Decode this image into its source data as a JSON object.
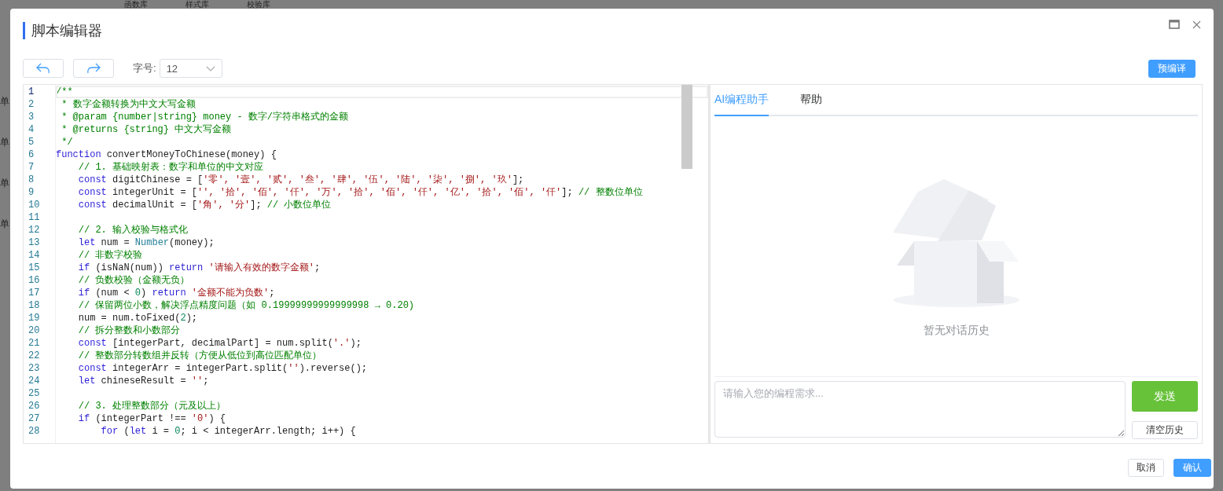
{
  "background": {
    "tabs": [
      "函数库",
      "样式库",
      "校验库"
    ],
    "row_labels": [
      "单",
      "单",
      "单",
      "单"
    ]
  },
  "dialog": {
    "title": "脚本编辑器"
  },
  "toolbar": {
    "font_size_label": "字号:",
    "font_size": "12",
    "precompile_button": "预编译"
  },
  "editor": {
    "lines": [
      {
        "number": "1",
        "active": true,
        "tokens": [
          {
            "kind": "comment",
            "text": "/**"
          }
        ]
      },
      {
        "number": "2",
        "active": false,
        "tokens": [
          {
            "kind": "comment",
            "text": " * 数字金额转换为中文大写金额"
          }
        ]
      },
      {
        "number": "3",
        "active": false,
        "tokens": [
          {
            "kind": "comment",
            "text": " * @param {number|string} money - 数字/字符串格式的金额"
          }
        ]
      },
      {
        "number": "4",
        "active": false,
        "tokens": [
          {
            "kind": "comment",
            "text": " * @returns {string} 中文大写金额"
          }
        ]
      },
      {
        "number": "5",
        "active": false,
        "tokens": [
          {
            "kind": "comment",
            "text": " */"
          }
        ]
      },
      {
        "number": "6",
        "active": false,
        "tokens": [
          {
            "kind": "keyword",
            "text": "function"
          },
          {
            "kind": "plain",
            "text": " convertMoneyToChinese(money) {"
          }
        ]
      },
      {
        "number": "7",
        "active": false,
        "tokens": [
          {
            "kind": "comment",
            "text": "    // 1. 基础映射表：数字和单位的中文对应"
          }
        ]
      },
      {
        "number": "8",
        "active": false,
        "tokens": [
          {
            "kind": "keyword",
            "text": "    const"
          },
          {
            "kind": "plain",
            "text": " digitChinese = ["
          },
          {
            "kind": "string",
            "text": "'零', '壹', '贰', '叁', '肆', '伍', '陆', '柒', '捌', '玖'"
          },
          {
            "kind": "plain",
            "text": "];"
          }
        ]
      },
      {
        "number": "9",
        "active": false,
        "tokens": [
          {
            "kind": "keyword",
            "text": "    const"
          },
          {
            "kind": "plain",
            "text": " integerUnit = ["
          },
          {
            "kind": "string",
            "text": "'', '拾', '佰', '仟', '万', '拾', '佰', '仟', '亿', '拾', '佰', '仟'"
          },
          {
            "kind": "plain",
            "text": "];"
          },
          {
            "kind": "comment",
            "text": " // 整数位单位"
          }
        ]
      },
      {
        "number": "10",
        "active": false,
        "tokens": [
          {
            "kind": "keyword",
            "text": "    const"
          },
          {
            "kind": "plain",
            "text": " decimalUnit = ["
          },
          {
            "kind": "string",
            "text": "'角', '分'"
          },
          {
            "kind": "plain",
            "text": "];"
          },
          {
            "kind": "comment",
            "text": " // 小数位单位"
          }
        ]
      },
      {
        "number": "11",
        "active": false
      },
      {
        "number": "12",
        "active": false,
        "tokens": [
          {
            "kind": "comment",
            "text": "    // 2. 输入校验与格式化"
          }
        ]
      },
      {
        "number": "13",
        "active": false,
        "tokens": [
          {
            "kind": "keyword",
            "text": "    let"
          },
          {
            "kind": "plain",
            "text": " num = "
          },
          {
            "kind": "type",
            "text": "Number"
          },
          {
            "kind": "plain",
            "text": "(money);"
          }
        ]
      },
      {
        "number": "14",
        "active": false,
        "tokens": [
          {
            "kind": "comment",
            "text": "    // 非数字校验"
          }
        ]
      },
      {
        "number": "15",
        "active": false,
        "tokens": [
          {
            "kind": "keyword",
            "text": "    if"
          },
          {
            "kind": "plain",
            "text": " (isNaN(num)) "
          },
          {
            "kind": "keyword",
            "text": "return"
          },
          {
            "kind": "string",
            "text": " '请输入有效的数字金额'"
          },
          {
            "kind": "plain",
            "text": ";"
          }
        ]
      },
      {
        "number": "16",
        "active": false,
        "tokens": [
          {
            "kind": "comment",
            "text": "    // 负数校验（金额无负）"
          }
        ]
      },
      {
        "number": "17",
        "active": false,
        "tokens": [
          {
            "kind": "keyword",
            "text": "    if"
          },
          {
            "kind": "plain",
            "text": " (num < "
          },
          {
            "kind": "number",
            "text": "0"
          },
          {
            "kind": "plain",
            "text": ") "
          },
          {
            "kind": "keyword",
            "text": "return"
          },
          {
            "kind": "string",
            "text": " '金额不能为负数'"
          },
          {
            "kind": "plain",
            "text": ";"
          }
        ]
      },
      {
        "number": "18",
        "active": false,
        "tokens": [
          {
            "kind": "comment",
            "text": "    // 保留两位小数，解决浮点精度问题（如 0.19999999999999998 → 0.20)"
          }
        ]
      },
      {
        "number": "19",
        "active": false,
        "tokens": [
          {
            "kind": "plain",
            "text": "    num = num.toFixed("
          },
          {
            "kind": "number",
            "text": "2"
          },
          {
            "kind": "plain",
            "text": ");"
          }
        ]
      },
      {
        "number": "20",
        "active": false,
        "tokens": [
          {
            "kind": "comment",
            "text": "    // 拆分整数和小数部分"
          }
        ]
      },
      {
        "number": "21",
        "active": false,
        "tokens": [
          {
            "kind": "keyword",
            "text": "    const"
          },
          {
            "kind": "plain",
            "text": " [integerPart, decimalPart] = num.split("
          },
          {
            "kind": "string",
            "text": "'.'"
          },
          {
            "kind": "plain",
            "text": ");"
          }
        ]
      },
      {
        "number": "22",
        "active": false,
        "tokens": [
          {
            "kind": "comment",
            "text": "    // 整数部分转数组并反转（方便从低位到高位匹配单位）"
          }
        ]
      },
      {
        "number": "23",
        "active": false,
        "tokens": [
          {
            "kind": "keyword",
            "text": "    const"
          },
          {
            "kind": "plain",
            "text": " integerArr = integerPart.split("
          },
          {
            "kind": "string",
            "text": "''"
          },
          {
            "kind": "plain",
            "text": ").reverse();"
          }
        ]
      },
      {
        "number": "24",
        "active": false,
        "tokens": [
          {
            "kind": "keyword",
            "text": "    let"
          },
          {
            "kind": "plain",
            "text": " chineseResult = "
          },
          {
            "kind": "string",
            "text": "''"
          },
          {
            "kind": "plain",
            "text": ";"
          }
        ]
      },
      {
        "number": "25",
        "active": false
      },
      {
        "number": "26",
        "active": false,
        "tokens": [
          {
            "kind": "comment",
            "text": "    // 3. 处理整数部分（元及以上）"
          }
        ]
      },
      {
        "number": "27",
        "active": false,
        "tokens": [
          {
            "kind": "keyword",
            "text": "    if"
          },
          {
            "kind": "plain",
            "text": " (integerPart !== "
          },
          {
            "kind": "string",
            "text": "'0'"
          },
          {
            "kind": "plain",
            "text": ") {"
          }
        ]
      },
      {
        "number": "28",
        "active": false,
        "tokens": [
          {
            "kind": "keyword",
            "text": "        for"
          },
          {
            "kind": "plain",
            "text": " ("
          },
          {
            "kind": "keyword",
            "text": "let"
          },
          {
            "kind": "plain",
            "text": " i = "
          },
          {
            "kind": "number",
            "text": "0"
          },
          {
            "kind": "plain",
            "text": "; i < integerArr.length; i++) {"
          }
        ]
      }
    ]
  },
  "assistant": {
    "tabs": [
      {
        "label": "AI编程助手",
        "selected": true
      },
      {
        "label": "帮助",
        "selected": false
      }
    ],
    "empty_text": "暂无对话历史",
    "input": {
      "placeholder": "请输入您的编程需求..."
    },
    "send_button": "发送",
    "clear_button": "清空历史"
  },
  "footer": {
    "buttons": [
      {
        "label": "取消",
        "kind": "secondary"
      },
      {
        "label": "确认",
        "kind": "primary"
      }
    ]
  }
}
